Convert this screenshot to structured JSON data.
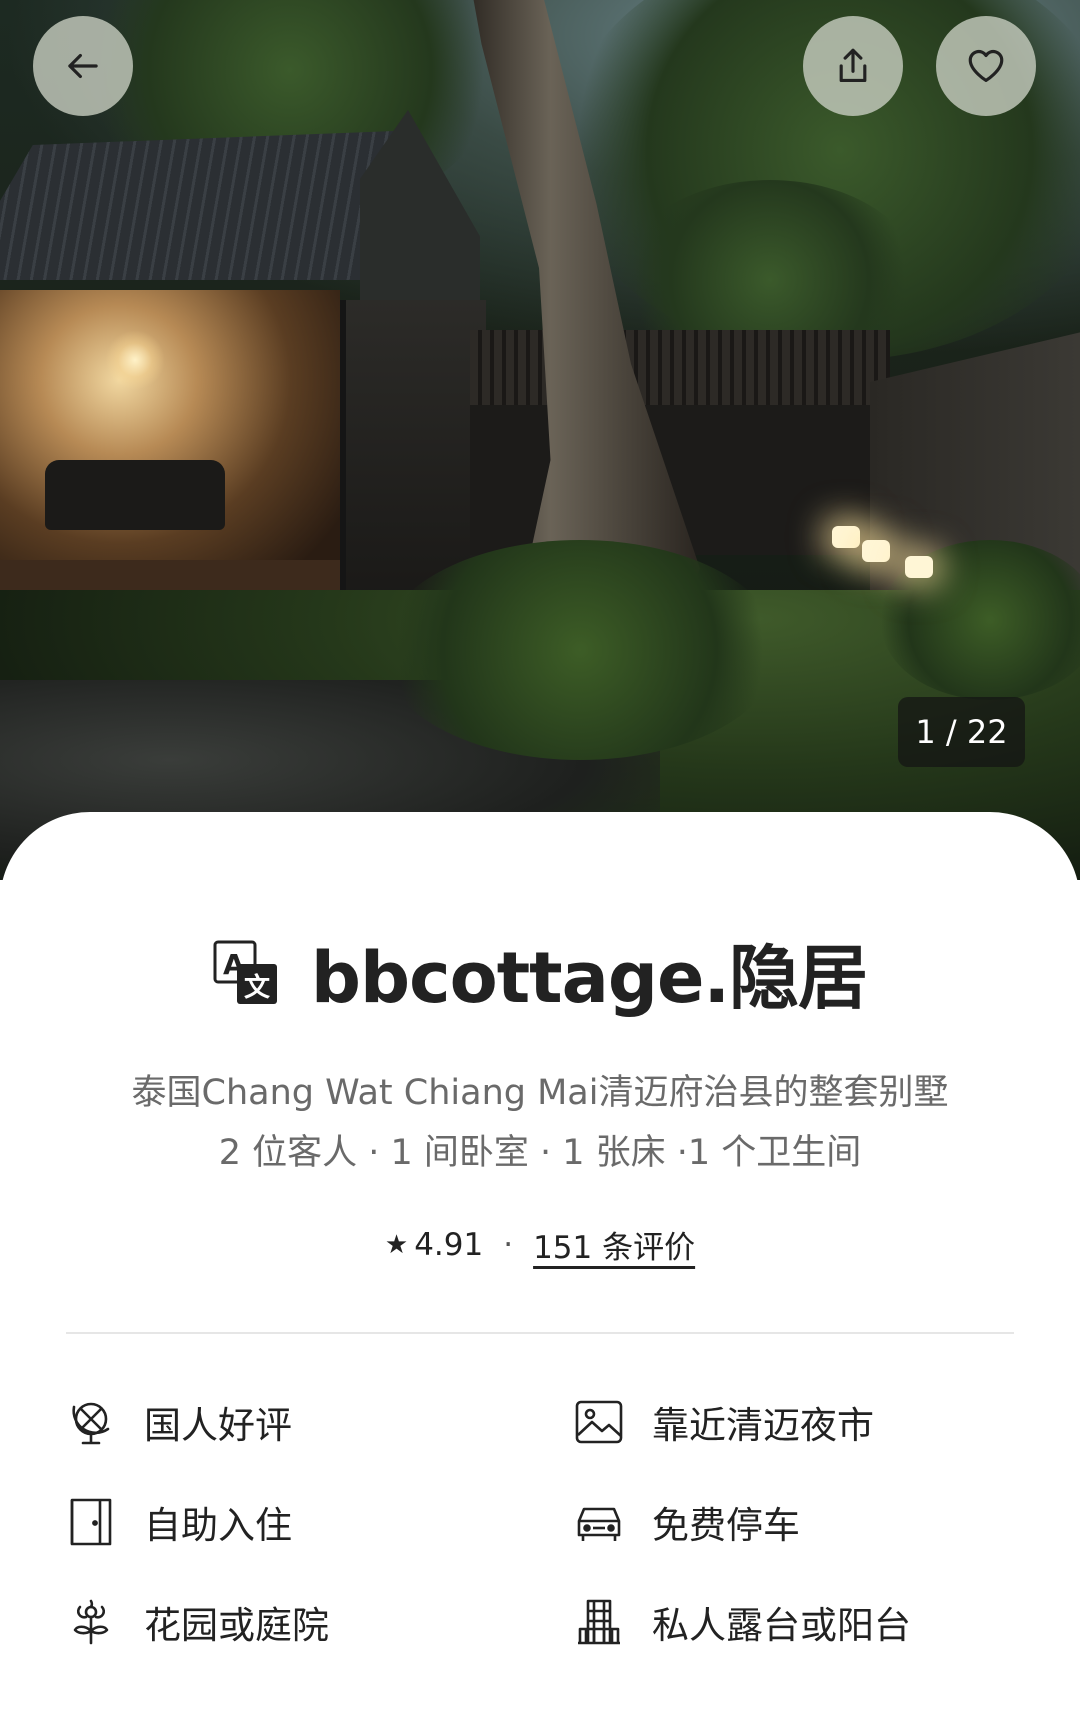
{
  "hero": {
    "photo_counter": "1 / 22",
    "back_icon": "arrow-left-icon",
    "share_icon": "share-icon",
    "favorite_icon": "heart-icon"
  },
  "listing": {
    "title": "bbcottage.隐居",
    "title_icon": "translate-icon",
    "subtitle": "泰国Chang Wat Chiang Mai清迈府治县的整套别墅",
    "details": "2 位客人 · 1 间卧室 · 1 张床 ·1 个卫生间",
    "rating": "4.91",
    "separator": "·",
    "reviews_link": "151 条评价"
  },
  "amenities": [
    {
      "label": "国人好评",
      "icon": "globe-icon"
    },
    {
      "label": "靠近清迈夜市",
      "icon": "image-icon"
    },
    {
      "label": "自助入住",
      "icon": "door-icon"
    },
    {
      "label": "免费停车",
      "icon": "car-icon"
    },
    {
      "label": "花园或庭院",
      "icon": "flower-icon"
    },
    {
      "label": "私人露台或阳台",
      "icon": "building-icon"
    }
  ]
}
